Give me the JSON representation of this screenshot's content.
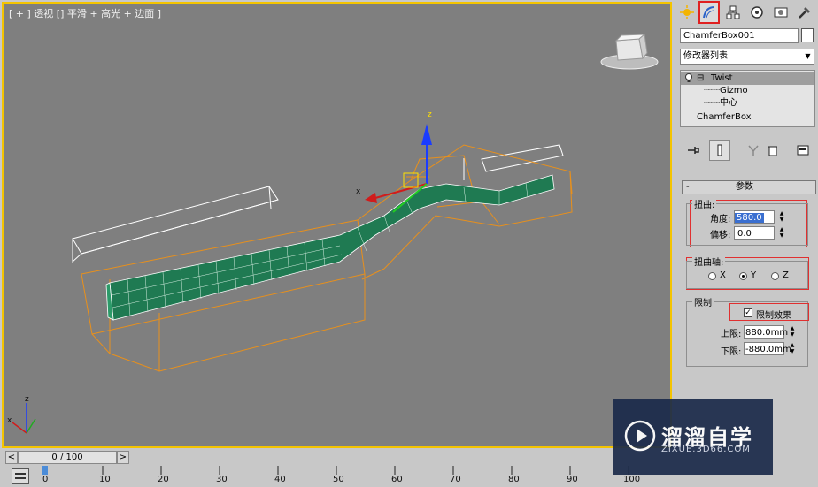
{
  "viewport": {
    "label": "[ + ] 透视 [] 平滑 + 高光 + 边面 ]",
    "gizmo_axis_z": "z",
    "gizmo_axis_x": "x",
    "corner_axis_z": "z",
    "corner_axis_x": "x"
  },
  "timeline": {
    "slider_label": "0 / 100",
    "prev_arrow": "<",
    "next_arrow": ">",
    "ruler_ticks": [
      "0",
      "10",
      "20",
      "30",
      "40",
      "50",
      "60",
      "70",
      "80",
      "90",
      "100"
    ]
  },
  "panel": {
    "tabs": [
      "create-tab",
      "modify-tab",
      "hierarchy-tab",
      "motion-tab",
      "display-tab",
      "utilities-tab"
    ],
    "object_name": "ChamferBox001",
    "object_color": "#ffffff",
    "modifier_list": "修改器列表",
    "stack": {
      "twist": "Twist",
      "gizmo": "Gizmo",
      "center": "中心",
      "base": "ChamferBox"
    },
    "rollout_title": "参数",
    "twist_group": "扭曲:",
    "angle_label": "角度:",
    "angle_value": "580.0",
    "bias_label": "偏移:",
    "bias_value": "0.0",
    "axis_group": "扭曲轴:",
    "axis_x": "X",
    "axis_y": "Y",
    "axis_z": "Z",
    "selected_axis": "Y",
    "limits_group": "限制",
    "limit_effect": "限制效果",
    "limit_checked": true,
    "upper_label": "上限:",
    "upper_value": "880.0mm",
    "lower_label": "下限:",
    "lower_value": "-880.0mm"
  },
  "watermark": {
    "brand": "溜溜自学",
    "url": "ZIXUE.3D66.COM"
  },
  "colors": {
    "viewport_bg": "#7f7f7f",
    "active_border": "#f4c400",
    "highlight": "#e02020",
    "mesh_green": "#1f7a52",
    "gizmo_orange": "#e8901c"
  }
}
